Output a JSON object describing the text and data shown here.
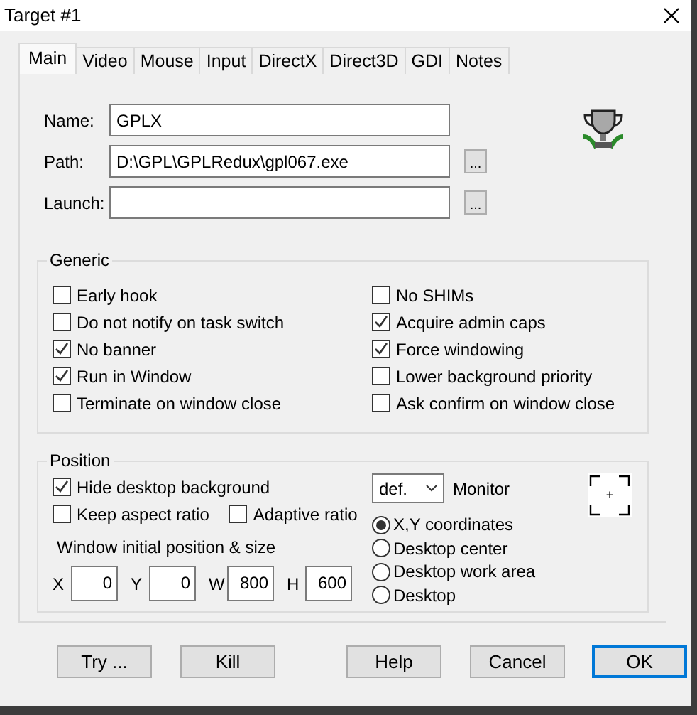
{
  "window": {
    "title": "Target #1"
  },
  "tabs": [
    {
      "label": "Main",
      "selected": true
    },
    {
      "label": "Video",
      "selected": false
    },
    {
      "label": "Mouse",
      "selected": false
    },
    {
      "label": "Input",
      "selected": false
    },
    {
      "label": "DirectX",
      "selected": false
    },
    {
      "label": "Direct3D",
      "selected": false
    },
    {
      "label": "GDI",
      "selected": false
    },
    {
      "label": "Notes",
      "selected": false
    }
  ],
  "fields": [
    {
      "label": "Name:",
      "value": "GPLX"
    },
    {
      "label": "Path:",
      "value": "D:\\GPL\\GPLRedux\\gpl067.exe",
      "browse": "..."
    },
    {
      "label": "Launch:",
      "browse": "..."
    }
  ],
  "generic": {
    "title": "Generic",
    "columns": [
      [
        {
          "label": "Early hook",
          "checked": false
        },
        {
          "label": "Do not notify on task switch",
          "checked": false
        },
        {
          "label": "No banner",
          "checked": true
        },
        {
          "label": "Run in Window",
          "checked": true
        },
        {
          "label": "Terminate on window close",
          "checked": false
        }
      ],
      [
        {
          "label": "No SHIMs",
          "checked": false
        },
        {
          "label": "Acquire admin caps",
          "checked": true
        },
        {
          "label": "Force windowing",
          "checked": true
        },
        {
          "label": "Lower background priority",
          "checked": false
        },
        {
          "label": "Ask confirm on window close",
          "checked": false
        }
      ]
    ]
  },
  "position": {
    "title": "Position",
    "hide_desktop": {
      "label": "Hide desktop background",
      "checked": true
    },
    "ratios": [
      {
        "label": "Keep aspect ratio",
        "checked": false
      },
      {
        "label": "Adaptive ratio",
        "checked": false
      }
    ],
    "size_caption": "Window initial position & size",
    "coords": [
      {
        "label": "X",
        "value": "0"
      },
      {
        "label": "Y",
        "value": "0"
      },
      {
        "label": "W",
        "value": "800"
      },
      {
        "label": "H",
        "value": "600"
      }
    ],
    "monitor": {
      "value": "def.",
      "label": "Monitor"
    },
    "placement": [
      {
        "label": "X,Y coordinates",
        "selected": true
      },
      {
        "label": "Desktop center",
        "selected": false
      },
      {
        "label": "Desktop work area",
        "selected": false
      },
      {
        "label": "Desktop",
        "selected": false
      }
    ],
    "pick_icon": "+"
  },
  "buttons": [
    {
      "label": "Try ...",
      "default": false
    },
    {
      "label": "Kill",
      "default": false
    },
    {
      "label": "Help",
      "default": false
    },
    {
      "label": "Cancel",
      "default": false
    },
    {
      "label": "OK",
      "default": true
    }
  ]
}
